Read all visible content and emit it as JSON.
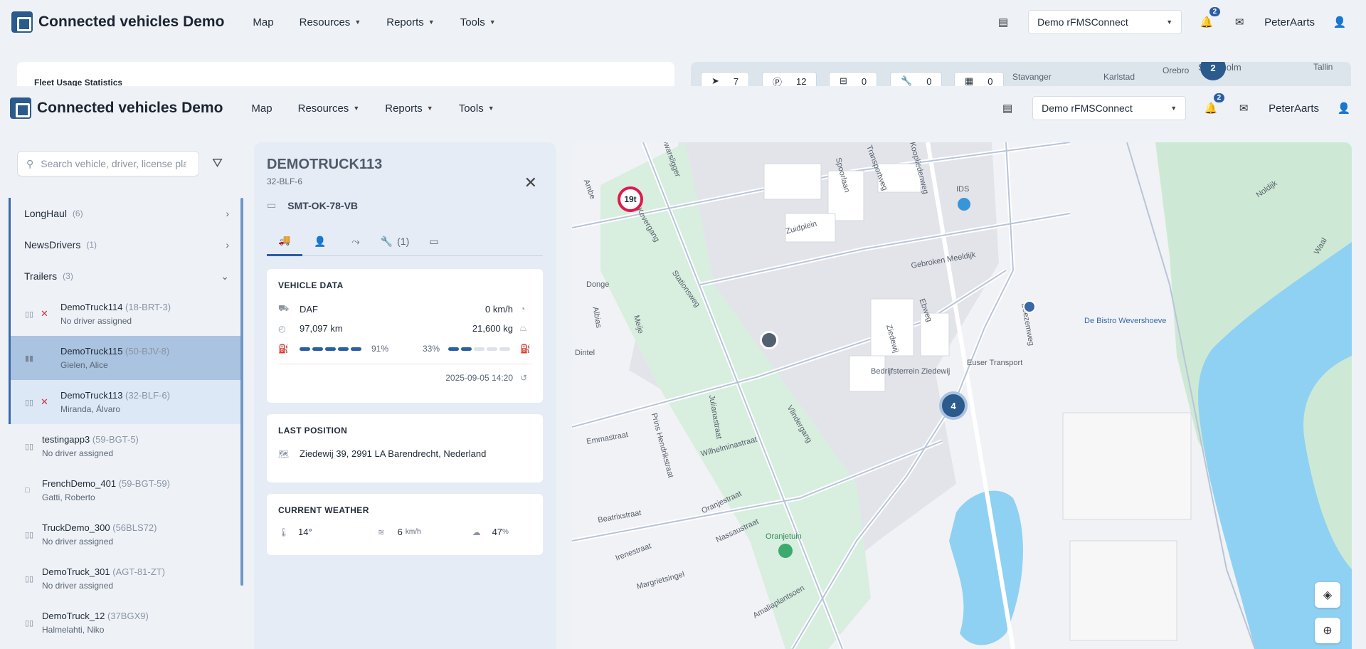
{
  "app": {
    "title": "Connected vehicles Demo",
    "nav": [
      "Map",
      "Resources",
      "Reports",
      "Tools"
    ],
    "account_select": "Demo rFMSConnect",
    "notifications_count": "2",
    "user": "PeterAarts"
  },
  "background": {
    "card_title": "Fleet Usage Statistics",
    "stats": [
      "7",
      "12",
      "0",
      "0",
      "0"
    ],
    "map_labels": [
      "Stavanger",
      "Karlstad",
      "Orebro",
      "Stockholm",
      "Tallin"
    ],
    "cluster": "2"
  },
  "sidebar": {
    "search_placeholder": "Search vehicle, driver, license plate",
    "groups": [
      {
        "name": "LongHaul",
        "count": "(6)"
      },
      {
        "name": "NewsDrivers",
        "count": "(1)"
      },
      {
        "name": "Trailers",
        "count": "(3)"
      }
    ],
    "vehicles": [
      {
        "name": "DemoTruck114",
        "plate": "(18-BRT-3)",
        "driver": "No driver assigned"
      },
      {
        "name": "DemoTruck115",
        "plate": "(50-BJV-8)",
        "driver": "Gielen, Alice"
      },
      {
        "name": "DemoTruck113",
        "plate": "(32-BLF-6)",
        "driver": "Miranda, Álvaro"
      },
      {
        "name": "testingapp3",
        "plate": "(59-BGT-5)",
        "driver": "No driver assigned"
      },
      {
        "name": "FrenchDemo_401",
        "plate": "(59-BGT-59)",
        "driver": "Gatti, Roberto"
      },
      {
        "name": "TruckDemo_300",
        "plate": "(56BLS72)",
        "driver": "No driver assigned"
      },
      {
        "name": "DemoTruck_301",
        "plate": "(AGT-81-ZT)",
        "driver": "No driver assigned"
      },
      {
        "name": "DemoTruck_12",
        "plate": "(37BGX9)",
        "driver": "Halmelahti, Niko"
      }
    ]
  },
  "detail": {
    "title": "DEMOTRUCK113",
    "plate": "32-BLF-6",
    "trailer": "SMT-OK-78-VB",
    "tab_service_count": "(1)",
    "vehicle_data": {
      "heading": "VEHICLE DATA",
      "make": "DAF",
      "speed": "0 km/h",
      "odometer": "97,097 km",
      "weight": "21,600 kg",
      "fuel_pct": "91%",
      "fuel_level": 0.91,
      "adblue_pct": "33%",
      "adblue_level": 0.33,
      "timestamp": "2025-09-05 14:20"
    },
    "last_position": {
      "heading": "LAST POSITION",
      "address": "Ziedewij 39, 2991 LA Barendrecht, Nederland"
    },
    "weather": {
      "heading": "CURRENT WEATHER",
      "temp": "14°",
      "wind": "6",
      "wind_unit": "km/h",
      "clouds": "47",
      "clouds_unit": "%"
    }
  },
  "map": {
    "labels": [
      "Dwarsligger",
      "Spoorlaan",
      "Transportweg",
      "Koopliedenweg",
      "Zuidplein",
      "IDS",
      "Gebroken Meeldijk",
      "Stationsweg",
      "Donge",
      "Albias",
      "Meije",
      "Dintel",
      "Ebweg",
      "Ziedewij",
      "Boezemweg",
      "De Bistro Wevershoeve",
      "Bedrijfsterrein Ziedewij",
      "Euser Transport",
      "Emmastraat",
      "Julianastraat",
      "Wilhelminastraat",
      "Prins Hendrikstraat",
      "Vlindergang",
      "Oranjestraat",
      "Nassaustraat",
      "Irenestraat",
      "Margrietsingel",
      "Beatrixstraat",
      "Oranjetuin",
      "Amaliaplantsoen",
      "Noldijk",
      "Waal",
      "Kevergang",
      "Ambe"
    ],
    "marker_weight": "19t",
    "cluster_count": "4"
  }
}
